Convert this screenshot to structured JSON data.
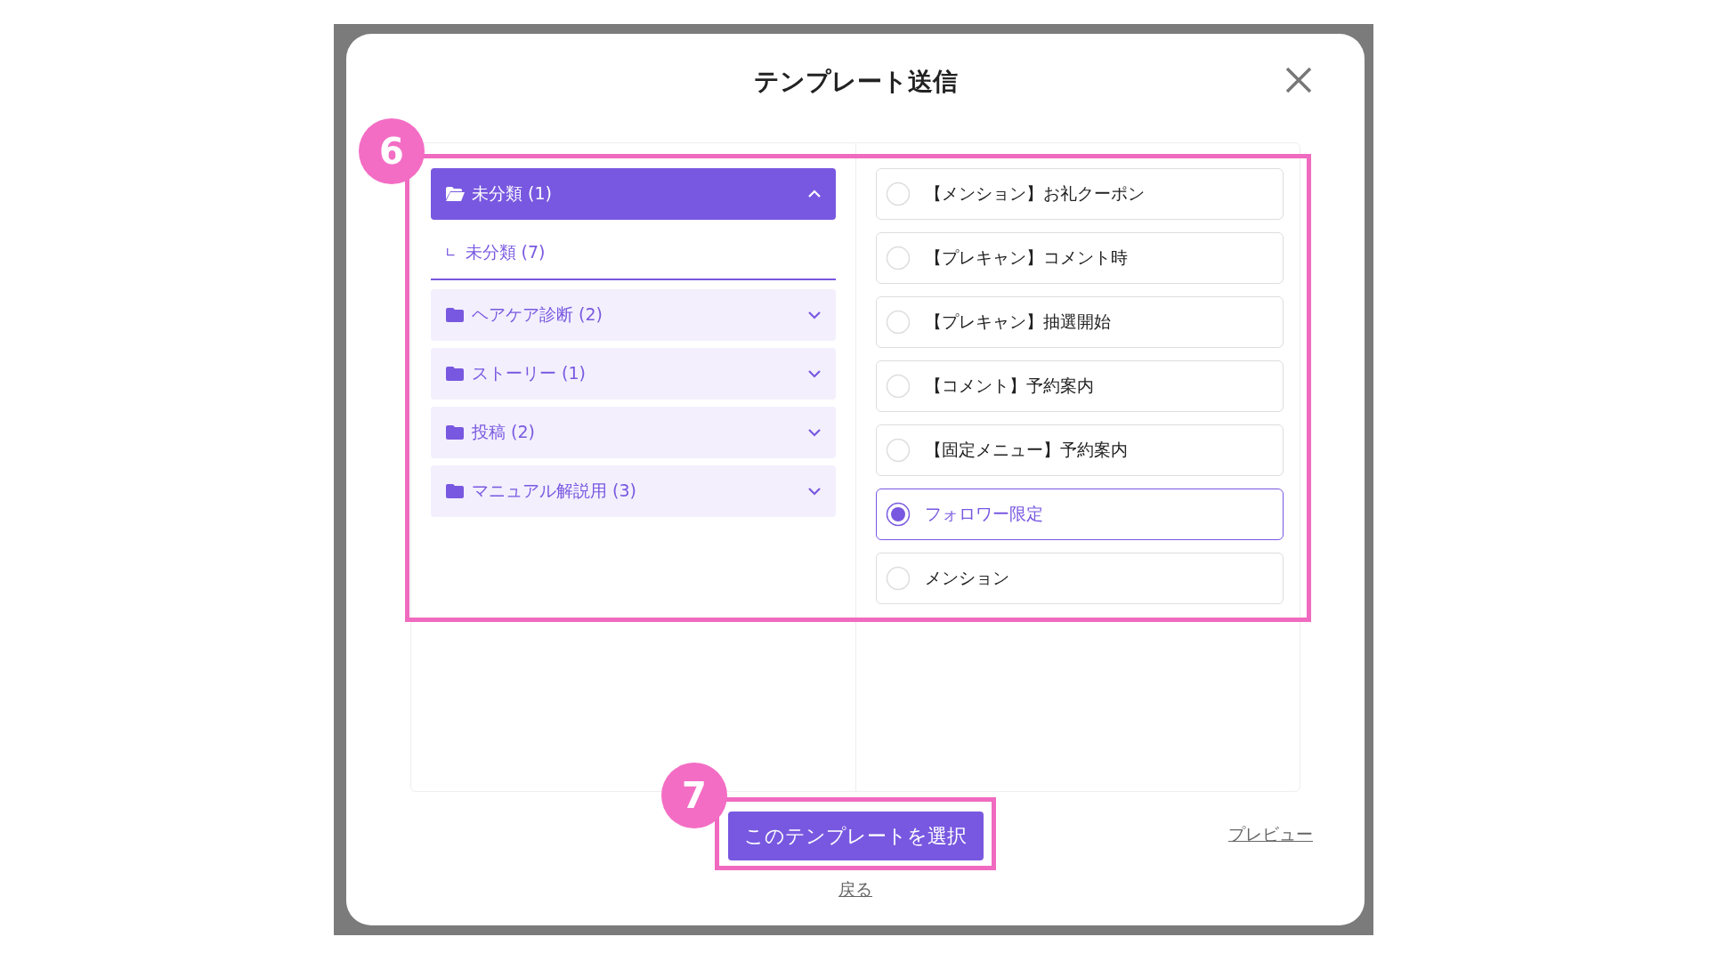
{
  "dialog": {
    "title": "テンプレート送信"
  },
  "folders": [
    {
      "label": "未分類 (1)",
      "expanded": true,
      "children": [
        {
          "marker": "∟",
          "label": "未分類 (7)",
          "selected": true
        }
      ]
    },
    {
      "label": "ヘアケア診断 (2)",
      "expanded": false
    },
    {
      "label": "ストーリー (1)",
      "expanded": false
    },
    {
      "label": "投稿 (2)",
      "expanded": false
    },
    {
      "label": "マニュアル解説用 (3)",
      "expanded": false
    }
  ],
  "templates": [
    {
      "label": "【メンション】お礼クーポン",
      "selected": false
    },
    {
      "label": "【プレキャン】コメント時",
      "selected": false
    },
    {
      "label": "【プレキャン】抽選開始",
      "selected": false
    },
    {
      "label": "【コメント】予約案内",
      "selected": false
    },
    {
      "label": "【固定メニュー】予約案内",
      "selected": false
    },
    {
      "label": "フォロワー限定",
      "selected": true
    },
    {
      "label": "メンション",
      "selected": false
    }
  ],
  "footer": {
    "primary_button": "このテンプレートを選択",
    "preview_link": "プレビュー",
    "back_link": "戻る"
  },
  "annotations": [
    {
      "number": "6"
    },
    {
      "number": "7"
    }
  ]
}
